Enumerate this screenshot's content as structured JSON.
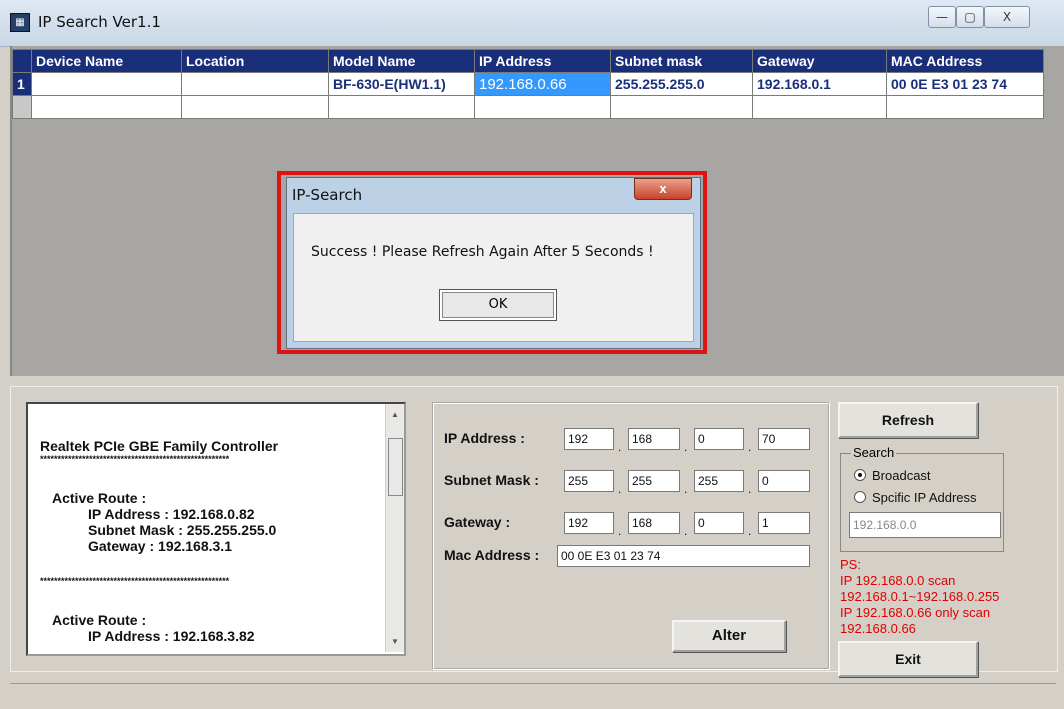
{
  "window": {
    "title": "IP Search Ver1.1",
    "minimize": "—",
    "maximize": "▢",
    "close": "X"
  },
  "grid": {
    "columns": [
      "Device Name",
      "Location",
      "Model Name",
      "IP Address",
      "Subnet mask",
      "Gateway",
      "MAC Address"
    ],
    "rows": [
      {
        "index": "1",
        "cells": [
          "",
          "",
          "BF-630-E(HW1.1)",
          "192.168.0.66",
          "255.255.255.0",
          "192.168.0.1",
          "00 0E E3 01 23 74"
        ]
      }
    ]
  },
  "dialog": {
    "title": "IP-Search",
    "close": "x",
    "message": "Success ! Please Refresh Again After 5 Seconds !",
    "ok": "OK"
  },
  "info": {
    "lines": [
      "Realtek PCIe GBE Family Controller",
      "******************************************************",
      "Active Route :",
      "IP Address : 192.168.0.82",
      "Subnet Mask : 255.255.255.0",
      "Gateway : 192.168.3.1",
      "******************************************************",
      "Active Route :",
      "IP Address : 192.168.3.82"
    ]
  },
  "form": {
    "ip_label": "IP Address :",
    "ip": [
      "192",
      "168",
      "0",
      "70"
    ],
    "mask_label": "Subnet Mask :",
    "mask": [
      "255",
      "255",
      "255",
      "0"
    ],
    "gw_label": "Gateway :",
    "gw": [
      "192",
      "168",
      "0",
      "1"
    ],
    "mac_label": "Mac Address :",
    "mac": "00 0E E3 01 23 74",
    "alter": "Alter"
  },
  "side": {
    "refresh": "Refresh",
    "search_label": "Search",
    "broadcast": "Broadcast",
    "specific": "Spcific IP Address",
    "specific_ip": "192.168.0.0",
    "ps": [
      "PS:",
      "IP 192.168.0.0 scan",
      "192.168.0.1~192.168.0.255",
      "IP 192.168.0.66 only scan",
      "192.168.0.66"
    ],
    "exit": "Exit"
  },
  "colors": {
    "header": "#1a2f7a",
    "selection": "#3399ff",
    "highlight_frame": "#e01313",
    "ps_text": "#e00000"
  }
}
